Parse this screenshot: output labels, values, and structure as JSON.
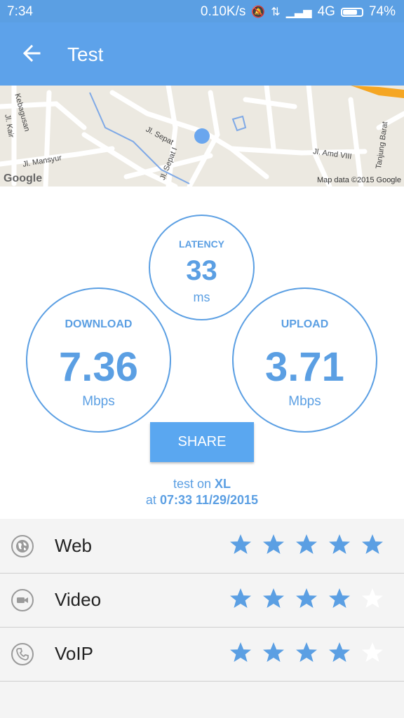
{
  "status_bar": {
    "time": "7:34",
    "network_speed": "0.10K/s",
    "network_type": "4G",
    "battery": "74%"
  },
  "app_bar": {
    "title": "Test"
  },
  "map": {
    "streets": [
      "Kebagusan",
      "Jl. Kair",
      "Jl. Mansyur",
      "Jl. Sepat",
      "Jl. Sepat I",
      "Jl. Amd VIII",
      "Tanjung Barat"
    ],
    "logo": "Google",
    "attribution": "Map data ©2015 Google"
  },
  "results": {
    "latency": {
      "label": "LATENCY",
      "value": "33",
      "unit": "ms"
    },
    "download": {
      "label": "DOWNLOAD",
      "value": "7.36",
      "unit": "Mbps"
    },
    "upload": {
      "label": "UPLOAD",
      "value": "3.71",
      "unit": "Mbps"
    }
  },
  "share_button": "SHARE",
  "test_info": {
    "prefix": "test on",
    "operator": "XL",
    "at_label": "at",
    "datetime": "07:33 11/29/2015"
  },
  "ratings": [
    {
      "label": "Web",
      "icon": "globe-icon",
      "stars": 5,
      "max": 5
    },
    {
      "label": "Video",
      "icon": "video-camera-icon",
      "stars": 4,
      "max": 5
    },
    {
      "label": "VoIP",
      "icon": "phone-icon",
      "stars": 4,
      "max": 5
    }
  ],
  "colors": {
    "accent": "#5b9fe3",
    "star_filled": "#5b9fe3",
    "star_empty": "#ffffff"
  }
}
